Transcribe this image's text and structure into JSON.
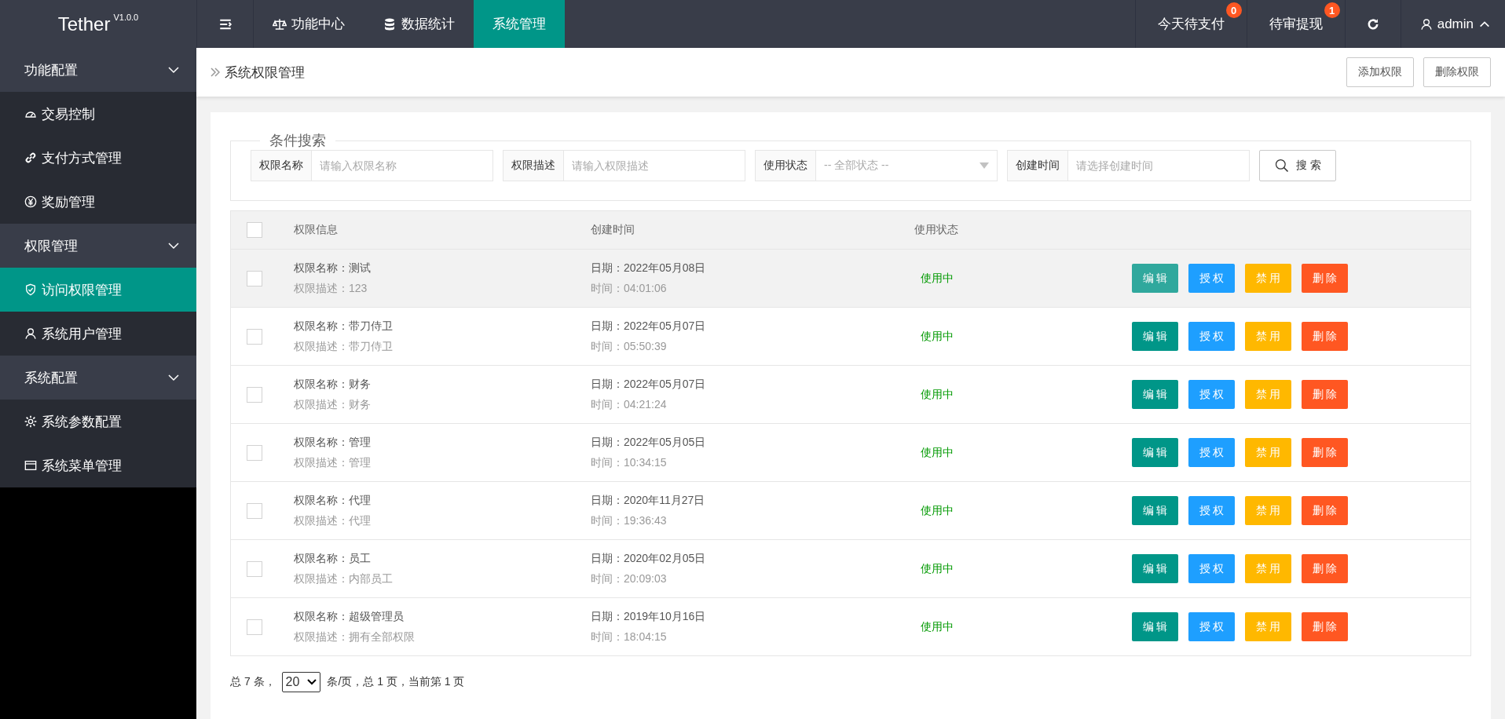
{
  "topbar": {
    "logo": "Tether",
    "version": "V1.0.0",
    "nav": [
      {
        "label": "功能中心",
        "selected": false
      },
      {
        "label": "数据统计",
        "selected": false
      },
      {
        "label": "系统管理",
        "selected": true
      }
    ],
    "notices": [
      {
        "label": "今天待支付",
        "badge": "0"
      },
      {
        "label": "待审提现",
        "badge": "1"
      }
    ],
    "user": "admin"
  },
  "sidebar": [
    {
      "label": "功能配置",
      "expanded": true,
      "children": [
        {
          "label": "交易控制",
          "selected": false
        },
        {
          "label": "支付方式管理",
          "selected": false
        },
        {
          "label": "奖励管理",
          "selected": false
        }
      ]
    },
    {
      "label": "权限管理",
      "expanded": true,
      "children": [
        {
          "label": "访问权限管理",
          "selected": true
        },
        {
          "label": "系统用户管理",
          "selected": false
        }
      ]
    },
    {
      "label": "系统配置",
      "expanded": true,
      "children": [
        {
          "label": "系统参数配置",
          "selected": false
        },
        {
          "label": "系统菜单管理",
          "selected": false
        }
      ]
    }
  ],
  "page": {
    "title": "系统权限管理",
    "actions": [
      "添加权限",
      "删除权限"
    ]
  },
  "search": {
    "legend": "条件搜索",
    "filters": [
      {
        "label": "权限名称",
        "kind": "text",
        "placeholder": "请输入权限名称"
      },
      {
        "label": "权限描述",
        "kind": "text",
        "placeholder": "请输入权限描述"
      },
      {
        "label": "使用状态",
        "kind": "select",
        "placeholder": "-- 全部状态 --"
      },
      {
        "label": "创建时间",
        "kind": "text",
        "placeholder": "请选择创建时间"
      }
    ],
    "button": "搜 索"
  },
  "table": {
    "select_all_checked": false,
    "columns": [
      "权限信息",
      "创建时间",
      "使用状态"
    ],
    "rows": [
      {
        "name": "权限名称：测试",
        "desc": "权限描述：123",
        "date": "日期：2022年05月08日",
        "time": "时间：04:01:06",
        "status": "使用中",
        "checked": false,
        "highlighted": true,
        "actions": [
          {
            "label": "编 辑",
            "kind": "edit"
          },
          {
            "label": "授 权",
            "kind": "grant"
          },
          {
            "label": "禁 用",
            "kind": "disable"
          },
          {
            "label": "删 除",
            "kind": "delete"
          }
        ]
      },
      {
        "name": "权限名称：带刀侍卫",
        "desc": "权限描述：带刀侍卫",
        "date": "日期：2022年05月07日",
        "time": "时间：05:50:39",
        "status": "使用中",
        "checked": false,
        "highlighted": false,
        "actions": [
          {
            "label": "编 辑",
            "kind": "edit"
          },
          {
            "label": "授 权",
            "kind": "grant"
          },
          {
            "label": "禁 用",
            "kind": "disable"
          },
          {
            "label": "删 除",
            "kind": "delete"
          }
        ]
      },
      {
        "name": "权限名称：财务",
        "desc": "权限描述：财务",
        "date": "日期：2022年05月07日",
        "time": "时间：04:21:24",
        "status": "使用中",
        "checked": false,
        "highlighted": false,
        "actions": [
          {
            "label": "编 辑",
            "kind": "edit"
          },
          {
            "label": "授 权",
            "kind": "grant"
          },
          {
            "label": "禁 用",
            "kind": "disable"
          },
          {
            "label": "删 除",
            "kind": "delete"
          }
        ]
      },
      {
        "name": "权限名称：管理",
        "desc": "权限描述：管理",
        "date": "日期：2022年05月05日",
        "time": "时间：10:34:15",
        "status": "使用中",
        "checked": false,
        "highlighted": false,
        "actions": [
          {
            "label": "编 辑",
            "kind": "edit"
          },
          {
            "label": "授 权",
            "kind": "grant"
          },
          {
            "label": "禁 用",
            "kind": "disable"
          },
          {
            "label": "删 除",
            "kind": "delete"
          }
        ]
      },
      {
        "name": "权限名称：代理",
        "desc": "权限描述：代理",
        "date": "日期：2020年11月27日",
        "time": "时间：19:36:43",
        "status": "使用中",
        "checked": false,
        "highlighted": false,
        "actions": [
          {
            "label": "编 辑",
            "kind": "edit"
          },
          {
            "label": "授 权",
            "kind": "grant"
          },
          {
            "label": "禁 用",
            "kind": "disable"
          },
          {
            "label": "删 除",
            "kind": "delete"
          }
        ]
      },
      {
        "name": "权限名称：员工",
        "desc": "权限描述：内部员工",
        "date": "日期：2020年02月05日",
        "time": "时间：20:09:03",
        "status": "使用中",
        "checked": false,
        "highlighted": false,
        "actions": [
          {
            "label": "编 辑",
            "kind": "edit"
          },
          {
            "label": "授 权",
            "kind": "grant"
          },
          {
            "label": "禁 用",
            "kind": "disable"
          },
          {
            "label": "删 除",
            "kind": "delete"
          }
        ]
      },
      {
        "name": "权限名称：超级管理员",
        "desc": "权限描述：拥有全部权限",
        "date": "日期：2019年10月16日",
        "time": "时间：18:04:15",
        "status": "使用中",
        "checked": false,
        "highlighted": false,
        "actions": [
          {
            "label": "编 辑",
            "kind": "edit"
          },
          {
            "label": "授 权",
            "kind": "grant"
          },
          {
            "label": "禁 用",
            "kind": "disable"
          },
          {
            "label": "删 除",
            "kind": "delete"
          }
        ]
      }
    ]
  },
  "pagination": {
    "total": "总 7 条，",
    "page_size": "20",
    "summary": "条/页，总 1 页，当前第 1 页"
  }
}
